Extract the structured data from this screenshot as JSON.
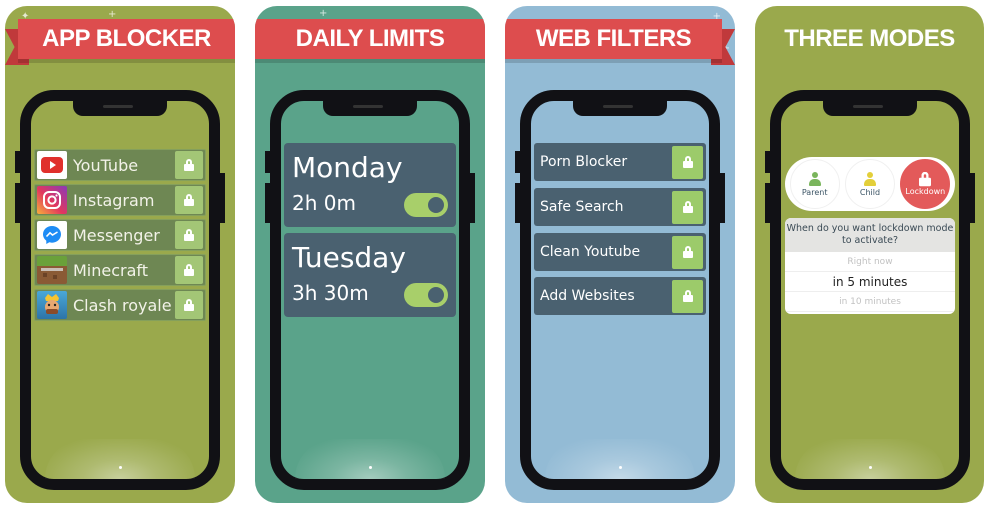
{
  "panels": {
    "app_blocker": {
      "title": "APP BLOCKER",
      "bg_color": "#9aa94c",
      "apps": [
        {
          "label": "YouTube",
          "icon": "youtube-icon",
          "locked": true
        },
        {
          "label": "Instagram",
          "icon": "instagram-icon",
          "locked": true
        },
        {
          "label": "Messenger",
          "icon": "messenger-icon",
          "locked": true
        },
        {
          "label": "Minecraft",
          "icon": "minecraft-icon",
          "locked": true
        },
        {
          "label": "Clash royale",
          "icon": "clash-royale-icon",
          "locked": true
        }
      ]
    },
    "daily_limits": {
      "title": "DAILY LIMITS",
      "bg_color": "#5aa38a",
      "days": [
        {
          "day": "Monday",
          "limit": "2h 0m",
          "enabled": true
        },
        {
          "day": "Tuesday",
          "limit": "3h 30m",
          "enabled": true
        }
      ]
    },
    "web_filters": {
      "title": "WEB FILTERS",
      "bg_color": "#93bbd5",
      "filters": [
        {
          "label": "Porn Blocker",
          "locked": true
        },
        {
          "label": "Safe Search",
          "locked": true
        },
        {
          "label": "Clean Youtube",
          "locked": true
        },
        {
          "label": "Add Websites",
          "locked": true
        }
      ]
    },
    "three_modes": {
      "title": "THREE MODES",
      "bg_color": "#9aa94c",
      "modes": [
        {
          "label": "Parent",
          "icon": "parent-icon",
          "active": false
        },
        {
          "label": "Child",
          "icon": "child-icon",
          "active": false
        },
        {
          "label": "Lockdown",
          "icon": "lock-icon",
          "active": true
        }
      ],
      "question": "When do you want lockdown mode to activate?",
      "options": [
        "Right now",
        "in 5 minutes",
        "in 10 minutes"
      ],
      "selected_option": "in 5 minutes"
    }
  },
  "colors": {
    "banner_red": "#dd4d4e",
    "card_slate": "#4a6170",
    "lock_green": "#9ccb6a",
    "lockdown_red": "#e35a5a"
  }
}
